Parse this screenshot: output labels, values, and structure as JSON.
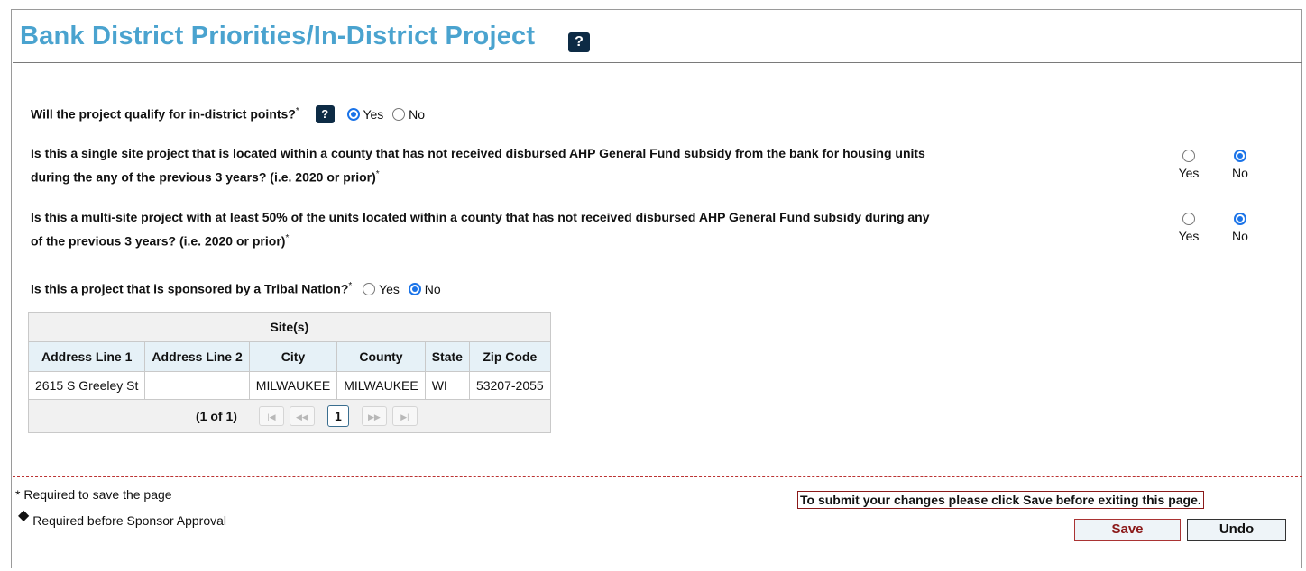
{
  "page": {
    "title": "Bank District Priorities/In-District Project",
    "help_label": "?"
  },
  "questions": {
    "q1": {
      "text": "Will the project qualify for in-district points?",
      "required_mark": "*",
      "help_label": "?",
      "yes_label": "Yes",
      "no_label": "No",
      "selected": "Yes"
    },
    "q2": {
      "text_line1": "Is this a single site project that is located within a county that has not received disbursed AHP General Fund subsidy from the bank for housing units",
      "text_line2": "during the any of the previous 3 years? (i.e. 2020 or prior)",
      "required_mark": "*",
      "yes_label": "Yes",
      "no_label": "No",
      "selected": "No"
    },
    "q3": {
      "text_line1": "Is this a multi-site project with at least 50% of the units located within a county that has not received disbursed AHP General Fund subsidy during any",
      "text_line2": "of the previous 3 years? (i.e. 2020 or prior)",
      "required_mark": "*",
      "yes_label": "Yes",
      "no_label": "No",
      "selected": "No"
    },
    "q4": {
      "text": "Is this a project that is sponsored by a Tribal Nation?",
      "required_mark": "*",
      "yes_label": "Yes",
      "no_label": "No",
      "selected": "No"
    }
  },
  "sites_table": {
    "caption": "Site(s)",
    "columns": [
      "Address Line 1",
      "Address Line 2",
      "City",
      "County",
      "State",
      "Zip Code"
    ],
    "rows": [
      [
        "2615 S Greeley St",
        "",
        "MILWAUKEE",
        "MILWAUKEE",
        "WI",
        "53207-2055"
      ]
    ],
    "pager": {
      "count": "(1 of 1)",
      "current_page": "1",
      "first_icon": "first-page-icon",
      "prev_icon": "prev-page-icon",
      "next_icon": "next-page-icon",
      "last_icon": "last-page-icon"
    }
  },
  "footer": {
    "required_save": "* Required to save the page",
    "required_sponsor_marker": "◆",
    "required_sponsor": "Required before Sponsor Approval",
    "notice": "To submit your changes please click Save before exiting this page.",
    "save_label": "Save",
    "undo_label": "Undo"
  },
  "colors": {
    "title": "#4aa3cf",
    "help_badge": "#0d2b45",
    "radio_selected": "#1a73e8",
    "column_header_bg": "#e6f1f7",
    "save_border": "#aa3333"
  }
}
